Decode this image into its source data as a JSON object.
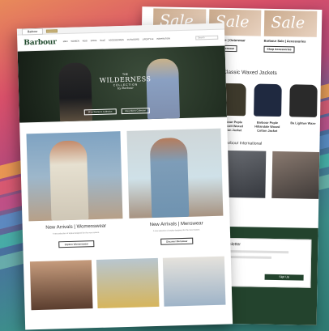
{
  "browser": {
    "tab_active": "Barbour",
    "tab_secondary": ""
  },
  "header": {
    "logo": "Barbour",
    "nav": [
      "Men",
      "Women",
      "Kids",
      "Dogs",
      "Sale",
      "Accessories",
      "Outdoors",
      "Lifestyle",
      "Inspiration"
    ],
    "search_placeholder": "Search"
  },
  "hero": {
    "the": "THE",
    "main": "WILDERNESS",
    "sub": "COLLECTION",
    "script": "by Barbour",
    "btn_women": "Shop Women's Collection",
    "btn_men": "Shop Men's Collection"
  },
  "cards": [
    {
      "title": "New Arrivals | Womenswear",
      "desc": "A new selection of styles designed for the new season.",
      "button": "Explore Womenswear"
    },
    {
      "title": "New Arrivals | Menswear",
      "desc": "A new selection of styles designed for the new season.",
      "button": "Discover Menswear"
    }
  ],
  "back_page": {
    "sale_word": "Sale",
    "sale_items": [
      {
        "caption": "Barbour Sale | Outerwear",
        "button": "Explore Outerwear"
      },
      {
        "caption": "Barbour Sale | Accessories",
        "button": "Shop Accessories"
      }
    ],
    "weed_title": "Discover Classic Waxed Jackets",
    "jackets": [
      {
        "label": "Barbour Pople Endicott Waxed Cotton Jacket",
        "color": "#3e3a2c"
      },
      {
        "label": "Barbour Pople Hillandale Waxed Cotton Jacket",
        "color": "#1f2940"
      },
      {
        "label": "Ba Lightwe Waxe",
        "color": "#2a2a2a"
      }
    ],
    "intl_title": "Barbour International",
    "newsletter_title": "Newsletter",
    "newsletter_btn": "Sign Up"
  }
}
